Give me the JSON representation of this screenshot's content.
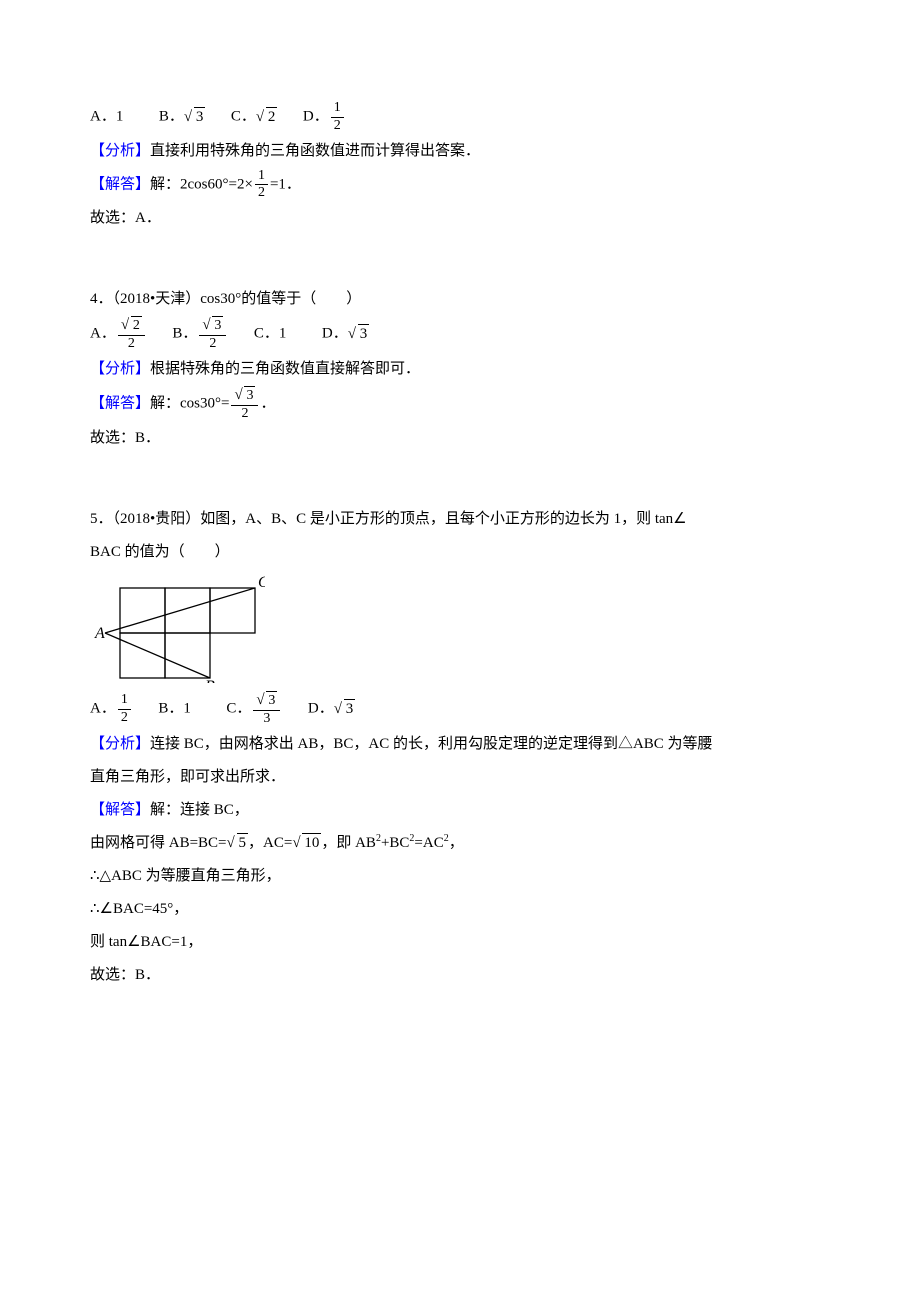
{
  "q3": {
    "optA_label": "A．",
    "optA_val": "1",
    "optB_label": "B．",
    "optB_rad": "3",
    "optC_label": "C．",
    "optC_rad": "2",
    "optD_label": "D．",
    "optD_num": "1",
    "optD_den": "2",
    "analysis_label": "【分析】",
    "analysis_text": "直接利用特殊角的三角函数值进而计算得出答案．",
    "solution_label": "【解答】",
    "solution_prefix": "解：2cos60°=2×",
    "sol_num": "1",
    "sol_den": "2",
    "solution_suffix": "=1．",
    "conclusion": "故选：A．"
  },
  "q4": {
    "stem": "4．（2018•天津）cos30°的值等于（　　）",
    "optA_label": "A．",
    "optA_num_rad": "2",
    "optA_den": "2",
    "optB_label": "B．",
    "optB_num_rad": "3",
    "optB_den": "2",
    "optC_label": "C．",
    "optC_val": "1",
    "optD_label": "D．",
    "optD_rad": "3",
    "analysis_label": "【分析】",
    "analysis_text": "根据特殊角的三角函数值直接解答即可．",
    "solution_label": "【解答】",
    "solution_prefix": "解：cos30°=",
    "sol_num_rad": "3",
    "sol_den": "2",
    "solution_suffix": "．",
    "conclusion": "故选：B．"
  },
  "q5": {
    "stem_l1": "5．（2018•贵阳）如图，A、B、C 是小正方形的顶点，且每个小正方形的边长为 1，则 tan∠",
    "stem_l2": "BAC 的值为（　　）",
    "fig": {
      "labelA": "A",
      "labelB": "B",
      "labelC": "C"
    },
    "optA_label": "A．",
    "optA_num": "1",
    "optA_den": "2",
    "optB_label": "B．",
    "optB_val": "1",
    "optC_label": "C．",
    "optC_num_rad": "3",
    "optC_den": "3",
    "optD_label": "D．",
    "optD_rad": "3",
    "analysis_label": "【分析】",
    "analysis_l1": "连接 BC，由网格求出 AB，BC，AC 的长，利用勾股定理的逆定理得到△ABC 为等腰",
    "analysis_l2": "直角三角形，即可求出所求．",
    "solution_label": "【解答】",
    "solution_l1": "解：连接 BC，",
    "solution_l2a": "由网格可得 AB=BC=",
    "sol_rad1": "5",
    "solution_l2b": "，AC=",
    "sol_rad2": "10",
    "solution_l2c": "，即 AB",
    "solution_l2d": "+BC",
    "solution_l2e": "=AC",
    "solution_l2f": "，",
    "solution_l3": "∴△ABC 为等腰直角三角形，",
    "solution_l4": "∴∠BAC=45°，",
    "solution_l5": "则 tan∠BAC=1，",
    "conclusion": "故选：B．"
  }
}
